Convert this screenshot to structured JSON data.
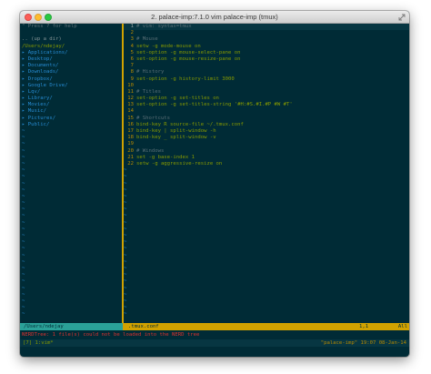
{
  "window": {
    "title": "2. palace-imp:7.1.0 vim palace-imp (tmux)"
  },
  "left_pane": {
    "help": "\" Press ? for help",
    "up_dir": ".. (up a dir)",
    "cwd": "/Users/ndejay/",
    "items": [
      "Applications/",
      "Desktop/",
      "Documents/",
      "Downloads/",
      "Dropbox/",
      "Google Drive/",
      "Lqv/",
      "Library/",
      "Movies/",
      "Music/",
      "Pictures/",
      "Public/"
    ],
    "tilde_char": "~"
  },
  "code": {
    "lines": [
      {
        "num": "1",
        "text": "# vim: syntax=tmux",
        "kind": "comment"
      },
      {
        "num": "2",
        "text": "",
        "kind": "text"
      },
      {
        "num": "3",
        "text": "# Mouse",
        "kind": "comment"
      },
      {
        "num": "4",
        "text": "setw -g mode-mouse on",
        "kind": "kw"
      },
      {
        "num": "5",
        "text": "set-option -g mouse-select-pane on",
        "kind": "kw"
      },
      {
        "num": "6",
        "text": "set-option -g mouse-resize-pane on",
        "kind": "kw"
      },
      {
        "num": "7",
        "text": "",
        "kind": "text"
      },
      {
        "num": "8",
        "text": "# History",
        "kind": "comment"
      },
      {
        "num": "9",
        "text": "set-option -g history-limit 3000",
        "kind": "kw"
      },
      {
        "num": "10",
        "text": "",
        "kind": "text"
      },
      {
        "num": "11",
        "text": "# Titles",
        "kind": "comment"
      },
      {
        "num": "12",
        "text": "set-option -g set-titles on",
        "kind": "kw"
      },
      {
        "num": "13",
        "text": "set-option -g set-titles-string '#H:#S.#I.#P #W #T'",
        "kind": "kw"
      },
      {
        "num": "14",
        "text": "",
        "kind": "text"
      },
      {
        "num": "15",
        "text": "# Shortcuts",
        "kind": "comment"
      },
      {
        "num": "16",
        "text": "bind-key R source-file ~/.tmux.conf",
        "kind": "kw"
      },
      {
        "num": "17",
        "text": "bind-key | split-window -h",
        "kind": "kw"
      },
      {
        "num": "18",
        "text": "bind-key _ split-window -v",
        "kind": "kw"
      },
      {
        "num": "19",
        "text": "",
        "kind": "text"
      },
      {
        "num": "20",
        "text": "# Windows",
        "kind": "comment"
      },
      {
        "num": "21",
        "text": "set -g base-index 1",
        "kind": "kw"
      },
      {
        "num": "22",
        "text": "setw -g aggressive-resize on",
        "kind": "kw"
      }
    ],
    "highlight_line": "1",
    "tilde_char": "~"
  },
  "statusline": {
    "left": "/Users/ndejay",
    "file": ".tmux.conf",
    "position": "1,1",
    "percent": "All"
  },
  "message": "NERDTree: 1 file(s) could not be loaded into the NERD tree",
  "tmux": {
    "window": "[7] 1:vim*",
    "status": "\"palace-imp\" 19:07 08-Jan-14"
  },
  "colors": {
    "background": "#002b36",
    "divider": "#d1a200",
    "status_left": "#2aa198",
    "message": "#dc322f"
  }
}
